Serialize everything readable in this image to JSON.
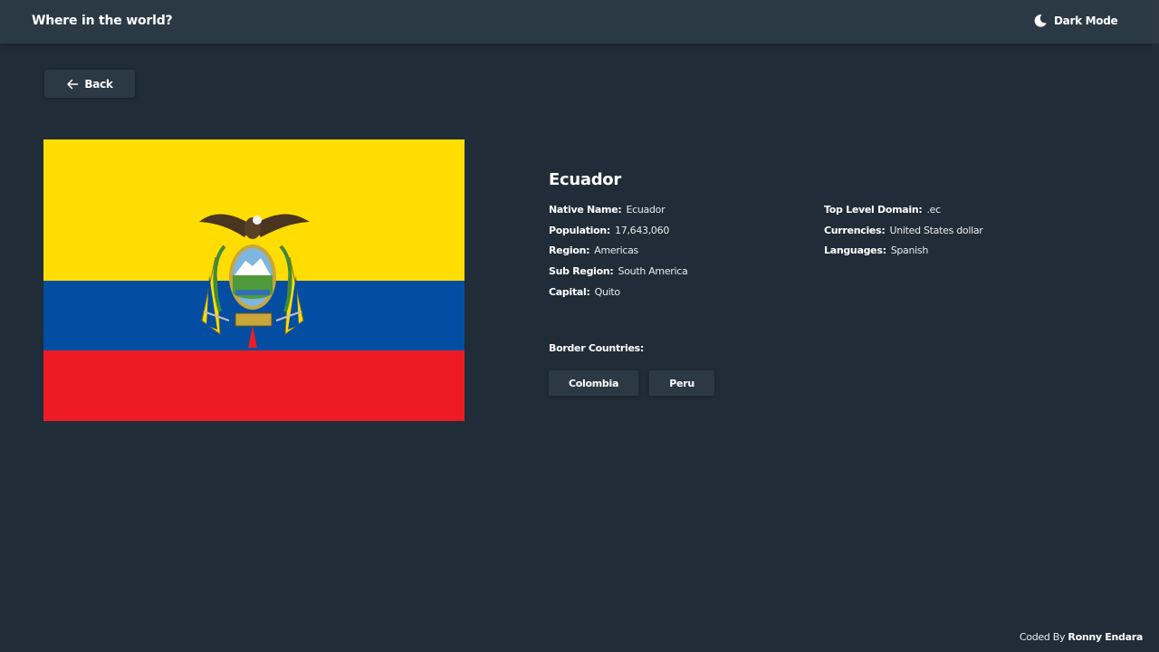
{
  "header": {
    "title": "Where in the world?",
    "theme_toggle_label": "Dark Mode",
    "theme_icon": "moon-icon"
  },
  "back_button": {
    "label": "Back",
    "icon": "arrow-left-icon"
  },
  "flag": {
    "icon": "ecuador-flag",
    "colors": {
      "yellow": "#ffdd00",
      "blue": "#034ea2",
      "red": "#ed1c24"
    }
  },
  "country": {
    "name": "Ecuador",
    "native_name_label": "Native Name:",
    "native_name": "Ecuador",
    "population_label": "Population:",
    "population": "17,643,060",
    "region_label": "Region:",
    "region": "Americas",
    "sub_region_label": "Sub Region:",
    "sub_region": "South America",
    "capital_label": "Capital:",
    "capital": "Quito",
    "tld_label": "Top Level Domain:",
    "tld": ".ec",
    "currencies_label": "Currencies:",
    "currencies": "United States dollar",
    "languages_label": "Languages:",
    "languages": "Spanish"
  },
  "borders": {
    "label": "Border Countries:",
    "items": [
      "Colombia",
      "Peru"
    ]
  },
  "footer": {
    "prefix": "Coded By",
    "author": "Ronny Endara"
  },
  "colors": {
    "background": "#202c37",
    "elements": "#2b3945",
    "text": "#ffffff"
  }
}
